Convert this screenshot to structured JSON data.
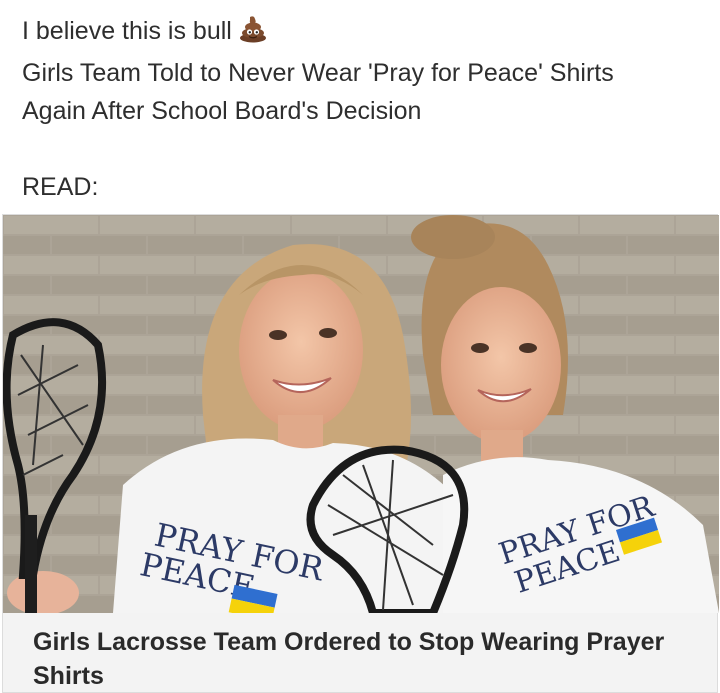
{
  "post": {
    "lines": [
      "I believe this is bull",
      "Girls Team Told to Never Wear 'Pray for Peace' Shirts",
      "Again After School Board's Decision",
      "READ:"
    ],
    "emoji_icon": "pile-of-poo-icon"
  },
  "link_preview": {
    "image_alt": "Two girls lacrosse players smiling in white 'PRAY FOR PEACE' shirts holding lacrosse sticks",
    "shirt_text": {
      "line1": "PRAY FOR",
      "line2": "PEACE"
    },
    "title_lines": [
      "Girls Lacrosse Team Ordered to Stop Wearing Prayer",
      "Shirts"
    ]
  },
  "colors": {
    "text": "#2e2e2e",
    "card_bg": "#f3f3f3",
    "ukraine_blue": "#2f6fd0",
    "ukraine_yellow": "#f5d20a",
    "shirt_print": "#2c3a66"
  }
}
